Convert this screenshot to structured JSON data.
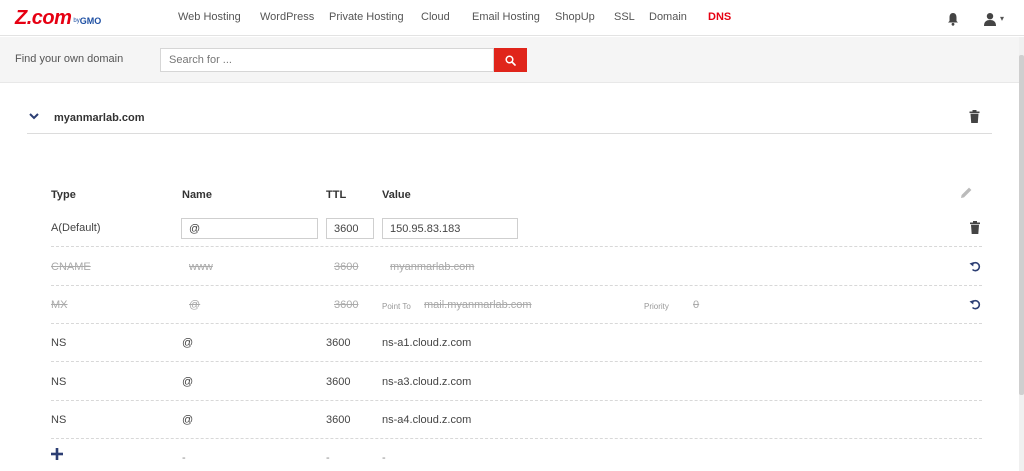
{
  "brand": {
    "logo_main": "Z.com",
    "logo_by": "by",
    "logo_gmo": "GMO"
  },
  "nav": {
    "items": [
      "Web Hosting",
      "WordPress",
      "Private Hosting",
      "Cloud",
      "Email Hosting",
      "ShopUp",
      "SSL",
      "Domain",
      "DNS"
    ],
    "active": "DNS"
  },
  "search": {
    "label": "Find your own domain",
    "placeholder": "Search for ...",
    "value": ""
  },
  "domain": {
    "name": "myanmarlab.com"
  },
  "table": {
    "headers": {
      "type": "Type",
      "name": "Name",
      "ttl": "TTL",
      "value": "Value"
    },
    "rows": [
      {
        "type": "A(Default)",
        "name": "@",
        "ttl": "3600",
        "value": "150.95.83.183",
        "state": "editing"
      },
      {
        "type": "CNAME",
        "name": "www",
        "ttl": "3600",
        "value": "myanmarlab.com",
        "state": "deleted"
      },
      {
        "type": "MX",
        "name": "@",
        "ttl": "3600",
        "point_to_label": "Point To",
        "value": "mail.myanmarlab.com",
        "priority_label": "Priority",
        "priority": "0",
        "state": "deleted"
      },
      {
        "type": "NS",
        "name": "@",
        "ttl": "3600",
        "value": "ns-a1.cloud.z.com",
        "state": "normal"
      },
      {
        "type": "NS",
        "name": "@",
        "ttl": "3600",
        "value": "ns-a3.cloud.z.com",
        "state": "normal"
      },
      {
        "type": "NS",
        "name": "@",
        "ttl": "3600",
        "value": "ns-a4.cloud.z.com",
        "state": "normal"
      }
    ],
    "new_row": {
      "name": "-",
      "ttl": "-",
      "value": "-"
    }
  },
  "colors": {
    "brand_red": "#e60012",
    "search_button": "#e0251b",
    "icon_blue": "#2c3e73"
  },
  "icons": [
    "bell-icon",
    "user-icon",
    "search-icon",
    "chevron-down-icon",
    "trash-icon",
    "edit-icon",
    "undo-icon",
    "plus-icon"
  ]
}
